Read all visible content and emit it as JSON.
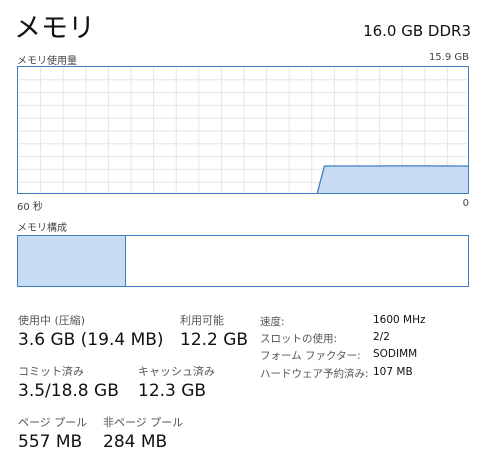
{
  "header": {
    "title": "メモリ",
    "subtitle": "16.0 GB DDR3"
  },
  "usage_graph": {
    "label": "メモリ使用量",
    "max_label": "15.9 GB",
    "x_left_label": "60 秒",
    "x_right_label": "0",
    "samples": [
      0,
      0,
      0,
      0,
      0,
      0,
      0,
      0,
      0,
      0,
      0,
      0,
      0,
      0,
      0,
      0,
      0,
      0,
      0,
      0,
      0,
      0,
      0,
      0,
      0,
      0,
      0,
      0,
      0,
      0,
      0,
      0,
      0,
      0,
      0,
      0,
      0,
      0,
      0,
      0,
      3.6,
      3.6,
      3.6,
      3.6,
      3.6,
      3.6,
      3.6,
      3.6,
      3.62,
      3.62,
      3.62,
      3.62,
      3.62,
      3.62,
      3.62,
      3.6,
      3.61,
      3.6,
      3.6,
      3.6
    ],
    "max": 15.9,
    "line_color": "#3d7fc1",
    "fill_color": "#c7dcf3"
  },
  "composition": {
    "label": "メモリ構成",
    "in_use_fraction": 0.23,
    "modified_fraction": 0.007
  },
  "stats": {
    "in_use_label": "使用中 (圧縮)",
    "in_use_value": "3.6 GB (19.4 MB)",
    "available_label": "利用可能",
    "available_value": "12.2 GB",
    "committed_label": "コミット済み",
    "committed_value": "3.5/18.8 GB",
    "cached_label": "キャッシュ済み",
    "cached_value": "12.3 GB",
    "paged_label": "ページ プール",
    "paged_value": "557 MB",
    "nonpaged_label": "非ページ プール",
    "nonpaged_value": "284 MB"
  },
  "properties": [
    {
      "label": "速度:",
      "value": "1600 MHz"
    },
    {
      "label": "スロットの使用:",
      "value": "2/2"
    },
    {
      "label": "フォーム ファクター:",
      "value": "SODIMM"
    },
    {
      "label": "ハードウェア予約済み:",
      "value": "107 MB"
    }
  ]
}
